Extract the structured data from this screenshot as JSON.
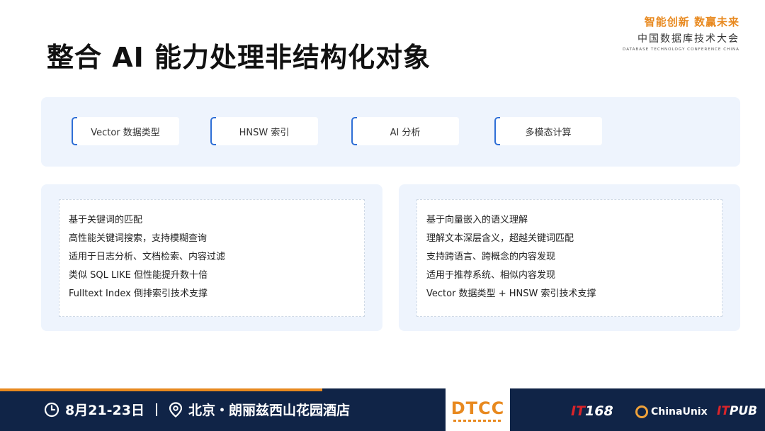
{
  "slide": {
    "title": "整合 AI 能力处理非结构化对象"
  },
  "brand": {
    "slogan": "智能创新 数赢未来",
    "name_cn": "中国数据库技术大会",
    "name_en": "DATABASE TECHNOLOGY CONFERENCE CHINA"
  },
  "features": [
    {
      "label": "Vector 数据类型"
    },
    {
      "label": "HNSW 索引"
    },
    {
      "label": "AI 分析"
    },
    {
      "label": "多模态计算"
    }
  ],
  "left_column": {
    "lines": [
      "基于关键词的匹配",
      "高性能关键词搜索，支持模糊查询",
      "适用于日志分析、文档检索、内容过滤",
      "类似 SQL LIKE 但性能提升数十倍",
      "Fulltext Index 倒排索引技术支撑"
    ]
  },
  "right_column": {
    "lines": [
      "基于向量嵌入的语义理解",
      "理解文本深层含义，超越关键词匹配",
      "支持跨语言、跨概念的内容发现",
      "适用于推荐系统、相似内容发现",
      "Vector 数据类型 + HNSW 索引技术支撑"
    ]
  },
  "footer": {
    "date": "8月21-23日",
    "venue": "北京・朗丽兹西山花园酒店",
    "event_logo": "DTCC",
    "partner_1a": "IT",
    "partner_1b": "168",
    "partner_2": "ChinaUnix",
    "partner_3a": "IT",
    "partner_3b": "PUB"
  },
  "colors": {
    "accent": "#e8891f",
    "chip_border": "#2f6fd6",
    "panel_bg": "#eef4fd",
    "footer_bg": "#102447"
  },
  "icons": {
    "date": "clock-icon",
    "venue": "location-pin-icon"
  }
}
